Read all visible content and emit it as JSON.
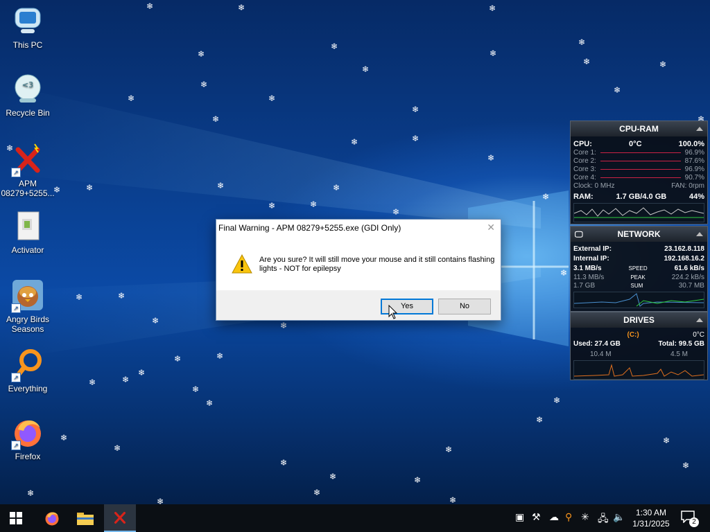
{
  "desktop_icons": [
    {
      "label": "This PC"
    },
    {
      "label": "Recycle Bin"
    },
    {
      "label": "APM 08279+5255..."
    },
    {
      "label": "Activator"
    },
    {
      "label": "Angry Birds Seasons"
    },
    {
      "label": "Everything"
    },
    {
      "label": "Firefox"
    }
  ],
  "cpu_widget": {
    "title": "CPU-RAM",
    "cpu_label": "CPU:",
    "cpu_temp": "0°C",
    "cpu_value": "100.0%",
    "cores": [
      {
        "label": "Core 1:",
        "value": "96.9%"
      },
      {
        "label": "Core 2:",
        "value": "87.6%"
      },
      {
        "label": "Core 3:",
        "value": "96.9%"
      },
      {
        "label": "Core 4:",
        "value": "90.7%"
      }
    ],
    "clock": "Clock: 0 MHz",
    "fan": "FAN: 0rpm",
    "ram_label": "RAM:",
    "ram_value": "1.7 GB/4.0 GB",
    "ram_pct": "44%"
  },
  "network_widget": {
    "title": "NETWORK",
    "external_label": "External IP:",
    "external_ip": "23.162.8.118",
    "internal_label": "Internal IP:",
    "internal_ip": "192.168.16.2",
    "speed_down": "3.1 MB/s",
    "speed_label": "SPEED",
    "speed_up": "61.6 kB/s",
    "peak_down": "11.3 MB/s",
    "peak_label": "PEAK",
    "peak_up": "224.2 kB/s",
    "sum_down": "1.7 GB",
    "sum_label": "SUM",
    "sum_up": "30.7 MB"
  },
  "drives_widget": {
    "title": "DRIVES",
    "drive": "(C:)",
    "temp": "0°C",
    "used": "Used: 27.4 GB",
    "total": "Total: 99.5 GB",
    "read": "10.4 M",
    "write": "4.5 M"
  },
  "dialog": {
    "title": "Final Warning - APM 08279+5255.exe (GDI Only)",
    "message": "Are you sure? It will still move your mouse and it still contains flashing lights - NOT for epilepsy",
    "yes": "Yes",
    "no": "No"
  },
  "taskbar": {
    "time": "1:30 AM",
    "date": "1/31/2025",
    "notifications": "2"
  },
  "colors": {
    "accent": "#0078d7",
    "core_bar": "#cc2244",
    "ram_graph": "#c8c8c8",
    "net_graph": "#2ecc40",
    "drive_graph": "#e0701e"
  }
}
